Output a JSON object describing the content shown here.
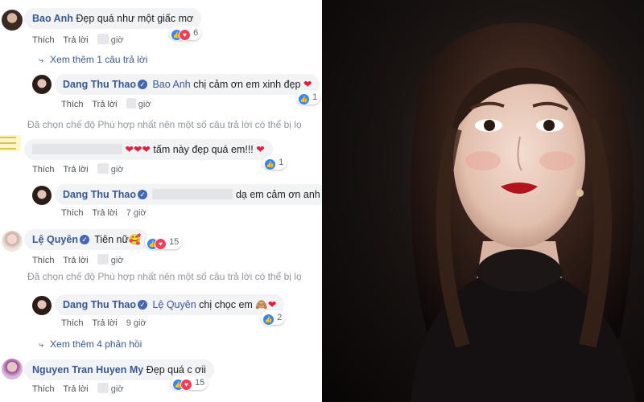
{
  "comments": [
    {
      "name": "Bao Anh",
      "text": "Đẹp quá như một giấc mơ",
      "like": "Thích",
      "reply": "Trả lời",
      "time": "giờ",
      "count": "6"
    },
    {
      "more": "Xem thêm 1 câu trả lời"
    },
    {
      "name": "Dang Thu Thao",
      "mention": "Bao Anh",
      "text": "chị cảm ơn em xinh đẹp",
      "like": "Thích",
      "reply": "Trả lời",
      "time": "giờ",
      "count": "1"
    },
    {
      "system": "Đã chọn chế độ Phù hợp nhất nên một số câu trả lời có thể bị lọ"
    },
    {
      "text": "tấm này đẹp quá em!!!",
      "like": "Thích",
      "reply": "Trả lời",
      "time": "giờ",
      "count": "1"
    },
    {
      "name": "Dang Thu Thao",
      "text": "dạ em cảm ơn anh",
      "like": "Thích",
      "reply": "Trả lời",
      "time": "7 giờ"
    },
    {
      "name": "Lệ Quyên",
      "text": "Tiên nữ",
      "like": "Thích",
      "reply": "Trả lời",
      "time": "giờ",
      "count": "15"
    },
    {
      "system": "Đã chọn chế độ Phù hợp nhất nên một số câu trả lời có thể bị lọ"
    },
    {
      "name": "Dang Thu Thao",
      "mention": "Lệ Quyên",
      "text": "chị chọc em",
      "like": "Thích",
      "reply": "Trả lời",
      "time": "9 giờ",
      "count": "2"
    },
    {
      "more": "Xem thêm 4 phản hồi"
    },
    {
      "name": "Nguyen Tran Huyen My",
      "text": "Đẹp quá c ơii",
      "like": "Thích",
      "reply": "Trả lời",
      "time": "giờ",
      "count": "15"
    }
  ],
  "colors": {
    "link": "#385898",
    "bubble": "#f2f3f5",
    "like": "#2d88ff",
    "love": "#f33e58"
  },
  "icons": [
    "verified-badge-icon",
    "like-reaction-icon",
    "love-reaction-icon",
    "heart-emoji",
    "reply-arrow-icon"
  ]
}
